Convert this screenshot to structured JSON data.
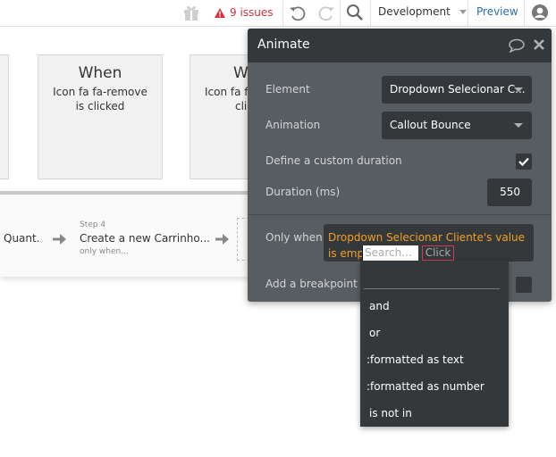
{
  "topbar": {
    "issues_label": "9 issues",
    "environment": "Development",
    "preview_label": "Preview",
    "colors": {
      "issues": "#d0333e",
      "preview": "#2a6fb5"
    }
  },
  "workflow": {
    "cards": [
      {
        "title": "When",
        "description": "Icon fa fa-remove is clicked"
      },
      {
        "title": "W",
        "description": "Icon fa fa-"
      }
    ],
    "card2_description_line2": "clic",
    "previous_step_text": "Quant.",
    "step4": {
      "label": "Step 4",
      "title": "Create a new Carrinho...",
      "condition": "only when..."
    }
  },
  "animate_panel": {
    "title": "Animate",
    "element_label": "Element",
    "element_value": "Dropdown Selecionar C...",
    "animation_label": "Animation",
    "animation_value": "Callout Bounce",
    "custom_duration_label": "Define a custom duration",
    "custom_duration_checked": true,
    "duration_label": "Duration (ms)",
    "duration_value": "550",
    "only_when_label": "Only when",
    "only_when_expression": "Dropdown Selecionar Cliente's value is empty",
    "search_placeholder": "Search...",
    "click_label": "Click",
    "breakpoint_label": "Add a breakpoint in",
    "colors": {
      "header": "#34383b",
      "body": "#585d61",
      "expression": "#f2a024"
    }
  },
  "dropdown": {
    "items": [
      "and",
      "or",
      ":formatted as text",
      ":formatted as number",
      "is not in"
    ]
  }
}
